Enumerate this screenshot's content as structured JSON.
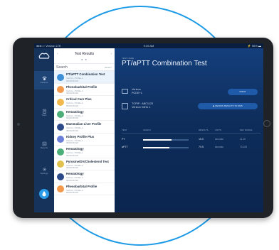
{
  "status_bar": {
    "carrier": "●●●○○ Verizon  LTE",
    "time": "9:39 AM",
    "battery": "⚡ 96% ▬"
  },
  "rail": {
    "items": [
      {
        "label": "Patients"
      },
      {
        "label": "Tests"
      },
      {
        "label": "Reports"
      },
      {
        "label": "Settings"
      }
    ]
  },
  "list_panel": {
    "title": "Test Results",
    "dots": "● ●",
    "prev_arrow": "‹",
    "next_arrow": "›",
    "search_label": "Search",
    "reset_label": "RESET",
    "rows": [
      {
        "title": "PT/aPTT Combination Test",
        "sub1": "Verizon, PCDE+1",
        "sub2": "09/03/18 AM",
        "color": "#3d8fd8"
      },
      {
        "title": "Phenobarbital Profile",
        "sub1": "Verizon, PCDE+1",
        "sub2": "09/03/18 AM",
        "color": "#f39a4c"
      },
      {
        "title": "Critical Care Plus",
        "sub1": "Verizon, PCDE+1",
        "sub2": "09/03/18 AM",
        "color": "#f3b94c"
      },
      {
        "title": "Hematology",
        "sub1": "Verizon, PCDE+1",
        "sub2": "09/03/18 AM",
        "color": "#4caf7a"
      },
      {
        "title": "Mammalian Liver Profile",
        "sub1": "Verizon, PCDE+1",
        "sub2": "09/03/18 AM",
        "color": "#2c4a8a"
      },
      {
        "title": "Kidney Profile Plus",
        "sub1": "Verizon, PCDE+1",
        "sub2": "09/03/18 AM",
        "color": "#6c7fd8"
      },
      {
        "title": "Hematology",
        "sub1": "Verizon, PCDE+1",
        "sub2": "09/03/18 AM",
        "color": "#4caf7a"
      },
      {
        "title": "Pyrosine/DV/Cholesterol Test",
        "sub1": "Verizon, PCDE+1",
        "sub2": "09/03/18 AM",
        "color": "#e0c24c"
      },
      {
        "title": "Hematology",
        "sub1": "Verizon, PCDE+1",
        "sub2": "09/03/18 AM",
        "color": "#2c4a8a"
      },
      {
        "title": "Phenobarbital Profile",
        "sub1": "Verizon, PCDE+1",
        "sub2": "09/03/18 AM",
        "color": "#f39a4c"
      }
    ]
  },
  "detail": {
    "caption": "TEST NAME",
    "title": "PT/aPTT Combination Test",
    "patient_line1": "Verizon",
    "patient_line2": "PCDE+1",
    "device_line1": "TCPIP : ABC1123",
    "device_line2": "Verizon VdHo 1",
    "print_label": "PRINT",
    "review_label": "REVIEW RESULTS TO RMS",
    "table": {
      "headers": [
        "TEST",
        "GRAPH",
        "RESULTS",
        "UNITS",
        "REF RANGE"
      ],
      "rows": [
        {
          "name": "PT",
          "fill": 0.62,
          "value": "15.0",
          "unit": "seconds",
          "range": "11-15"
        },
        {
          "name": "aPTT",
          "fill": 0.58,
          "value": "79.5",
          "unit": "seconds",
          "range": "70-105"
        }
      ]
    }
  }
}
